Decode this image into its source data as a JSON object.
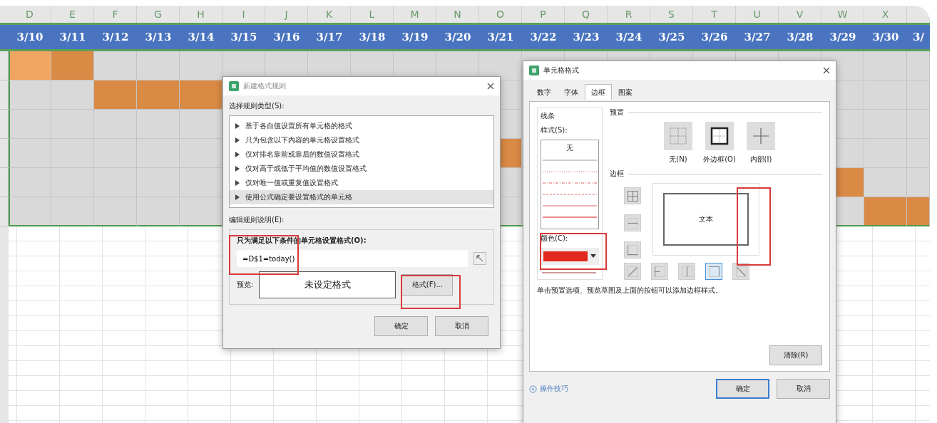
{
  "sheet": {
    "column_letters": [
      "D",
      "E",
      "F",
      "G",
      "H",
      "I",
      "J",
      "K",
      "L",
      "M",
      "N",
      "O",
      "P",
      "Q",
      "R",
      "S",
      "T",
      "U",
      "V",
      "W",
      "X"
    ],
    "dates": [
      "3/10",
      "3/11",
      "3/12",
      "3/13",
      "3/14",
      "3/15",
      "3/16",
      "3/17",
      "3/18",
      "3/19",
      "3/20",
      "3/21",
      "3/22",
      "3/23",
      "3/24",
      "3/25",
      "3/26",
      "3/27",
      "3/28",
      "3/29",
      "3/30",
      "3/"
    ],
    "rows": [
      {
        "cells": [
          {
            "color": "#f0a560"
          },
          {
            "color": "#d98a45"
          },
          {
            "color": "#d9d9d9"
          },
          {
            "color": "#d9d9d9"
          },
          {
            "color": "#d9d9d9"
          },
          {
            "color": "#d9d9d9"
          },
          {
            "color": "#d9d9d9"
          },
          {
            "color": "#d9d9d9"
          },
          {
            "color": "#d9d9d9"
          },
          {
            "color": "#d9d9d9"
          },
          {
            "color": "#d9d9d9"
          },
          {
            "color": "#d9d9d9"
          },
          {
            "color": "#d9d9d9"
          },
          {
            "color": "#d9d9d9"
          },
          {
            "color": "#d9d9d9"
          },
          {
            "color": "#d9d9d9"
          },
          {
            "color": "#d9d9d9"
          },
          {
            "color": "#d9d9d9"
          },
          {
            "color": "#d9d9d9"
          },
          {
            "color": "#d9d9d9"
          },
          {
            "color": "#d9d9d9"
          },
          {
            "color": "#d9d9d9"
          }
        ]
      },
      {
        "cells": [
          {
            "color": "#d9d9d9"
          },
          {
            "color": "#d9d9d9"
          },
          {
            "color": "#d98a45"
          },
          {
            "color": "#d98a45"
          },
          {
            "color": "#d98a45"
          },
          {},
          {},
          {},
          {},
          {},
          {},
          {
            "color": "#d9d9d9"
          },
          {},
          {},
          {},
          {},
          {},
          {},
          {},
          {
            "color": "#d9d9d9"
          },
          {
            "color": "#d9d9d9"
          },
          {
            "color": "#d9d9d9"
          }
        ]
      },
      {
        "cells": [
          {
            "color": "#d9d9d9"
          },
          {
            "color": "#d9d9d9"
          },
          {
            "color": "#d9d9d9"
          },
          {
            "color": "#d9d9d9"
          },
          {
            "color": "#d9d9d9"
          },
          {},
          {},
          {},
          {},
          {},
          {},
          {
            "color": "#d9d9d9"
          },
          {},
          {},
          {},
          {},
          {},
          {},
          {},
          {
            "color": "#d9d9d9"
          },
          {
            "color": "#d9d9d9"
          },
          {
            "color": "#d9d9d9"
          }
        ]
      },
      {
        "cells": [
          {
            "color": "#d9d9d9"
          },
          {
            "color": "#d9d9d9"
          },
          {
            "color": "#d9d9d9"
          },
          {
            "color": "#d9d9d9"
          },
          {
            "color": "#d9d9d9"
          },
          {},
          {},
          {},
          {},
          {},
          {},
          {
            "color": "#d98a45"
          },
          {},
          {},
          {},
          {},
          {},
          {},
          {},
          {
            "color": "#d9d9d9"
          },
          {
            "color": "#d9d9d9"
          },
          {
            "color": "#d9d9d9"
          }
        ]
      },
      {
        "cells": [
          {
            "color": "#d9d9d9"
          },
          {
            "color": "#d9d9d9"
          },
          {
            "color": "#d9d9d9"
          },
          {
            "color": "#d9d9d9"
          },
          {
            "color": "#d9d9d9"
          },
          {},
          {},
          {},
          {},
          {},
          {},
          {
            "color": "#d9d9d9"
          },
          {},
          {},
          {},
          {},
          {},
          {},
          {},
          {
            "color": "#d98a45"
          },
          {
            "color": "#d9d9d9"
          },
          {
            "color": "#d9d9d9"
          }
        ]
      },
      {
        "cells": [
          {
            "color": "#d9d9d9"
          },
          {
            "color": "#d9d9d9"
          },
          {
            "color": "#d9d9d9"
          },
          {
            "color": "#d9d9d9"
          },
          {
            "color": "#d9d9d9"
          },
          {},
          {},
          {},
          {},
          {},
          {},
          {
            "color": "#d9d9d9"
          },
          {},
          {},
          {},
          {},
          {},
          {},
          {},
          {
            "color": "#d9d9d9"
          },
          {
            "color": "#d98a45"
          },
          {
            "color": "#d98a45"
          }
        ]
      }
    ]
  },
  "rule_dialog": {
    "title": "新建格式规则",
    "rule_type_label": "选择规则类型(S):",
    "rule_types": [
      {
        "label": "基于各自值设置所有单元格的格式",
        "selected": false
      },
      {
        "label": "只为包含以下内容的单元格设置格式",
        "selected": false
      },
      {
        "label": "仅对排名靠前或靠后的数值设置格式",
        "selected": false
      },
      {
        "label": "仅对高于或低于平均值的数值设置格式",
        "selected": false
      },
      {
        "label": "仅对唯一值或重复值设置格式",
        "selected": false
      },
      {
        "label": "使用公式确定要设置格式的单元格",
        "selected": true
      }
    ],
    "edit_label": "编辑规则说明(E):",
    "condition_label": "只为满足以下条件的单元格设置格式(O):",
    "formula": "=D$1=today()",
    "preview_label": "预览:",
    "preview_text": "未设定格式",
    "format_button": "格式(F)...",
    "buttons": [
      "确定",
      "取消"
    ]
  },
  "border_dialog": {
    "title": "单元格格式",
    "tabs": [
      {
        "label": "数字",
        "selected": false
      },
      {
        "label": "字体",
        "selected": false
      },
      {
        "label": "边框",
        "selected": true
      },
      {
        "label": "图案",
        "selected": false
      }
    ],
    "line_heading": "线条",
    "style_label": "样式(S):",
    "style_none": "无",
    "color_label": "颜色(C):",
    "color": "#e0281e",
    "preset_heading": "预置",
    "presets": [
      "无(N)",
      "外边框(O)",
      "内部(I)"
    ],
    "border_heading": "边框",
    "preview_text": "文本",
    "hint": "单击预置选项、预览草图及上面的按钮可以添加边框样式。",
    "clear_button": "清除(R)",
    "tips_link": "操作技巧",
    "buttons": [
      "确定",
      "取消"
    ]
  }
}
